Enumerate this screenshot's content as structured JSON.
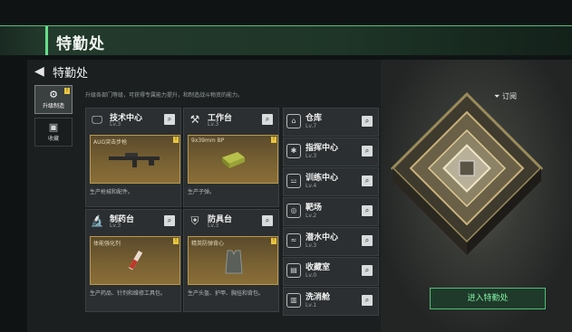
{
  "header": {
    "title": "特勤处"
  },
  "section": {
    "back_icon": "back-arrow-icon",
    "title": "特勤处",
    "description": "升级各部门等级，可获得专属能力提升，和制造战斗物资的能力。"
  },
  "side_tabs": [
    {
      "label": "升级制造",
      "icon": "gear-plus-icon",
      "badge": "!",
      "active": true
    },
    {
      "label": "收藏",
      "icon": "collection-icon",
      "active": false
    }
  ],
  "cards": [
    {
      "name": "技术中心",
      "level": "Lv.3",
      "icon": "monitor-icon",
      "product": "AUG突击步枪",
      "product_desc": "生产枪械和配件。",
      "badge": "!"
    },
    {
      "name": "工作台",
      "level": "Lv.3",
      "icon": "tools-icon",
      "product": "9x39mm BP",
      "product_desc": "生产子弹。",
      "badge": "!"
    },
    {
      "name": "制药台",
      "level": "Lv.3",
      "icon": "microscope-icon",
      "product": "体能强化剂",
      "product_desc": "生产药品、针剂和维修工具包。",
      "badge": "!"
    },
    {
      "name": "防具台",
      "level": "Lv.3",
      "icon": "armor-icon",
      "product": "精英防弹背心",
      "product_desc": "生产头盔、护甲、胸挂和背包。",
      "badge": "!"
    }
  ],
  "facilities": [
    {
      "name": "仓库",
      "level": "Lv.7",
      "icon": "warehouse-icon"
    },
    {
      "name": "指挥中心",
      "level": "Lv.3",
      "icon": "command-icon"
    },
    {
      "name": "训练中心",
      "level": "Lv.4",
      "icon": "dumbbell-icon"
    },
    {
      "name": "靶场",
      "level": "Lv.2",
      "icon": "target-icon"
    },
    {
      "name": "潜水中心",
      "level": "Lv.3",
      "icon": "diving-icon"
    },
    {
      "name": "收藏室",
      "level": "Lv.0",
      "icon": "vault-icon"
    },
    {
      "name": "洗消舱",
      "level": "Lv.1",
      "icon": "decontamination-icon"
    }
  ],
  "subscribe_label": "订阅",
  "enter_button": "进入特勤处",
  "colors": {
    "accent_green": "#66e08a",
    "badge_yellow": "#e8c640"
  }
}
